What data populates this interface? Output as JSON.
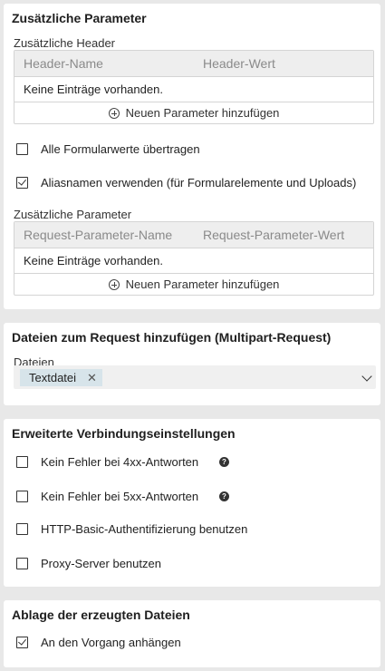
{
  "extra_params": {
    "title": "Zusätzliche Parameter",
    "header_section_label": "Zusätzliche Header",
    "header_table": {
      "col_name": "Header-Name",
      "col_value": "Header-Wert",
      "empty_text": "Keine Einträge vorhanden.",
      "add_label": "Neuen Parameter hinzufügen"
    },
    "checkbox_all_form_values": {
      "label": "Alle Formularwerte übertragen",
      "checked": false
    },
    "checkbox_alias_names": {
      "label": "Aliasnamen verwenden (für Formularelemente und Uploads)",
      "checked": true
    },
    "request_section_label": "Zusätzliche Parameter",
    "request_table": {
      "col_name": "Request-Parameter-Name",
      "col_value": "Request-Parameter-Wert",
      "empty_text": "Keine Einträge vorhanden.",
      "add_label": "Neuen Parameter hinzufügen"
    }
  },
  "files": {
    "title": "Dateien zum Request hinzufügen (Multipart-Request)",
    "field_label": "Dateien",
    "selected_tag": "Textdatei",
    "tag_close_glyph": "✕"
  },
  "connection": {
    "title": "Erweiterte Verbindungseinstellungen",
    "options": [
      {
        "label": "Kein Fehler bei 4xx-Antworten",
        "checked": false,
        "help": true
      },
      {
        "label": "Kein Fehler bei 5xx-Antworten",
        "checked": false,
        "help": true
      },
      {
        "label": "HTTP-Basic-Authentifizierung benutzen",
        "checked": false,
        "help": false
      },
      {
        "label": "Proxy-Server benutzen",
        "checked": false,
        "help": false
      }
    ],
    "help_glyph": "?"
  },
  "storage": {
    "title": "Ablage der erzeugten Dateien",
    "option": {
      "label": "An den Vorgang anhängen",
      "checked": true
    }
  }
}
